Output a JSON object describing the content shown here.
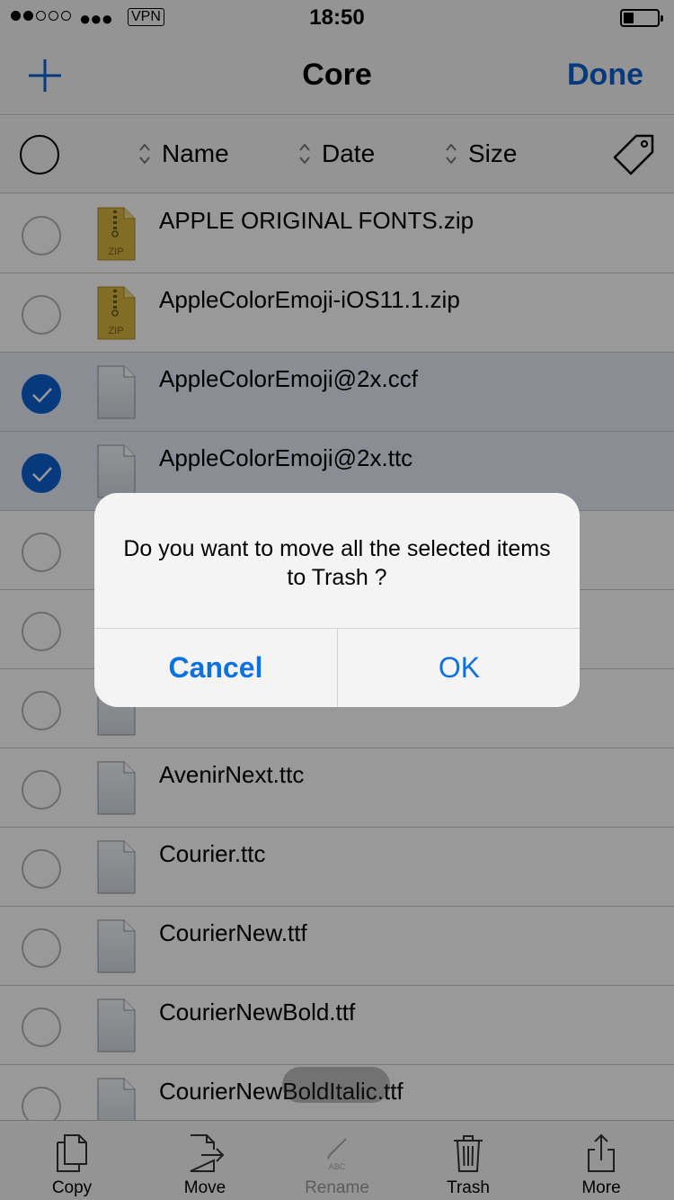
{
  "status": {
    "carrier": "●●●",
    "vpn": "VPN",
    "time": "18:50"
  },
  "nav": {
    "title": "Core",
    "done": "Done"
  },
  "sort": {
    "name": "Name",
    "date": "Date",
    "size": "Size"
  },
  "files": [
    {
      "name": "APPLE ORIGINAL FONTS.zip",
      "type": "zip",
      "selected": false
    },
    {
      "name": "AppleColorEmoji-iOS11.1.zip",
      "type": "zip",
      "selected": false
    },
    {
      "name": "AppleColorEmoji@2x.ccf",
      "type": "file",
      "selected": true
    },
    {
      "name": "AppleColorEmoji@2x.ttc",
      "type": "file",
      "selected": true
    },
    {
      "name": "",
      "type": "file",
      "selected": false
    },
    {
      "name": "",
      "type": "file",
      "selected": false
    },
    {
      "name": "",
      "type": "file",
      "selected": false
    },
    {
      "name": "AvenirNext.ttc",
      "type": "file",
      "selected": false
    },
    {
      "name": "Courier.ttc",
      "type": "file",
      "selected": false
    },
    {
      "name": "CourierNew.ttf",
      "type": "file",
      "selected": false
    },
    {
      "name": "CourierNewBold.ttf",
      "type": "file",
      "selected": false
    },
    {
      "name": "CourierNewBoldItalic.ttf",
      "type": "file",
      "selected": false
    }
  ],
  "zip_label": "ZIP",
  "toolbar": {
    "copy": "Copy",
    "move": "Move",
    "rename": "Rename",
    "rename_icon_text": "ABC",
    "trash": "Trash",
    "more": "More"
  },
  "alert": {
    "message": "Do you want to move all the selected items to Trash ?",
    "cancel": "Cancel",
    "ok": "OK"
  },
  "colors": {
    "accent": "#0a62d0",
    "selected_row": "#e6ecf6"
  }
}
